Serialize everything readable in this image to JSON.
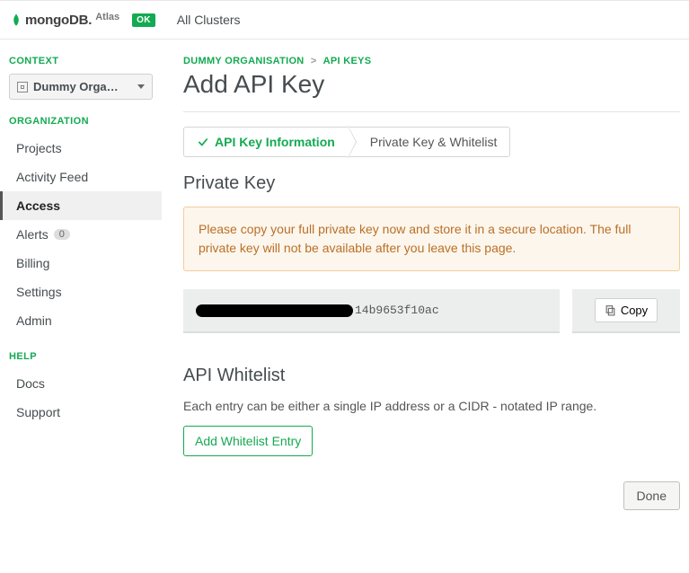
{
  "topbar": {
    "logo_main": "mongoDB",
    "logo_sub": "Atlas",
    "status_badge": "OK",
    "link": "All Clusters"
  },
  "sidebar": {
    "context_heading": "CONTEXT",
    "context_value": "Dummy Organ…",
    "org_heading": "ORGANIZATION",
    "org_items": [
      "Projects",
      "Activity Feed",
      "Access",
      "Alerts",
      "Billing",
      "Settings",
      "Admin"
    ],
    "alerts_count": "0",
    "help_heading": "HELP",
    "help_items": [
      "Docs",
      "Support"
    ]
  },
  "breadcrumb": {
    "org": "DUMMY ORGANISATION",
    "sep": ">",
    "page": "API KEYS"
  },
  "page_title": "Add API Key",
  "steps": {
    "s1": "API Key Information",
    "s2": "Private Key & Whitelist"
  },
  "private_key": {
    "heading": "Private Key",
    "warning": "Please copy your full private key now and store it in a secure location. The full private key will not be available after you leave this page.",
    "visible_suffix": "14b9653f10ac",
    "copy_label": "Copy"
  },
  "whitelist": {
    "heading": "API Whitelist",
    "desc": "Each entry can be either a single IP address or a CIDR - notated IP range.",
    "add_label": "Add Whitelist Entry"
  },
  "done_label": "Done"
}
